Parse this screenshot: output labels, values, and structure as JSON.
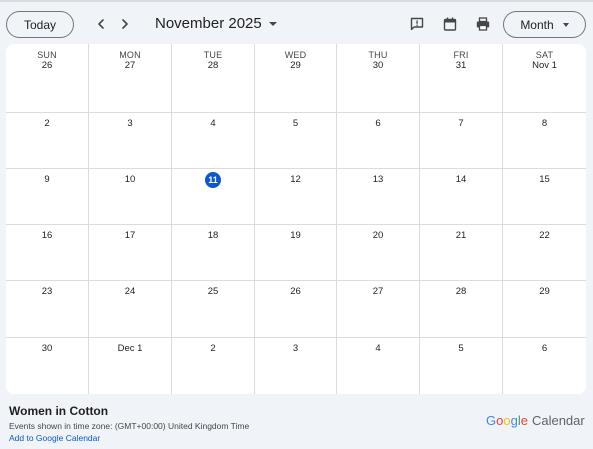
{
  "toolbar": {
    "today_label": "Today",
    "month_title": "November 2025",
    "view_label": "Month",
    "icons": [
      "prev-icon",
      "next-icon",
      "feedback-icon",
      "calendar-icon",
      "print-icon"
    ]
  },
  "calendar": {
    "weekdays": [
      "SUN",
      "MON",
      "TUE",
      "WED",
      "THU",
      "FRI",
      "SAT"
    ],
    "weeks": [
      [
        "26",
        "27",
        "28",
        "29",
        "30",
        "31",
        "Nov 1"
      ],
      [
        "2",
        "3",
        "4",
        "5",
        "6",
        "7",
        "8"
      ],
      [
        "9",
        "10",
        "11",
        "12",
        "13",
        "14",
        "15"
      ],
      [
        "16",
        "17",
        "18",
        "19",
        "20",
        "21",
        "22"
      ],
      [
        "23",
        "24",
        "25",
        "26",
        "27",
        "28",
        "29"
      ],
      [
        "30",
        "Dec 1",
        "2",
        "3",
        "4",
        "5",
        "6"
      ]
    ],
    "today": "11"
  },
  "footer": {
    "calendar_name": "Women in Cotton",
    "timezone_text": "Events shown in time zone: (GMT+00:00) United Kingdom Time",
    "add_link": "Add to Google Calendar",
    "brand_google": "Google",
    "brand_calendar": "Calendar"
  },
  "colors": {
    "today_highlight": "#0b57d0",
    "link": "#0b57d0",
    "google_letters": [
      "#4285f4",
      "#ea4335",
      "#fbbc05",
      "#4285f4",
      "#34a853",
      "#ea4335"
    ]
  }
}
